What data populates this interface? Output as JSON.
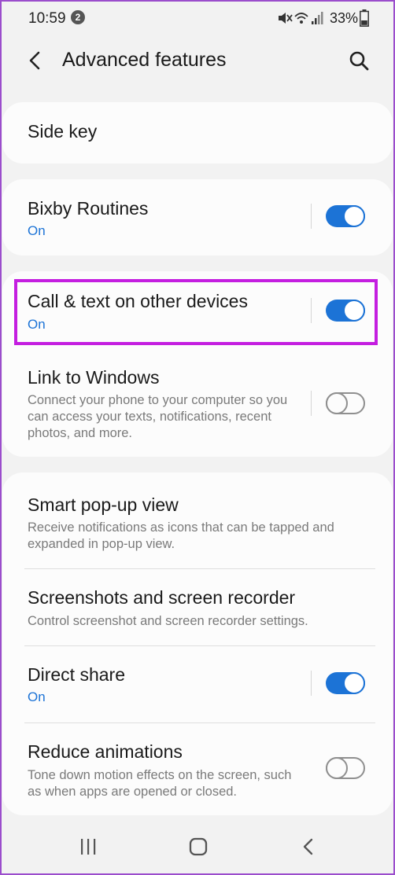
{
  "status_bar": {
    "time": "10:59",
    "notification_count": "2",
    "battery": "33%",
    "icons": [
      "mute-icon",
      "wifi-icon",
      "signal-icon",
      "battery-icon"
    ]
  },
  "header": {
    "title": "Advanced features",
    "back_icon": "back-arrow-icon",
    "search_icon": "search-icon"
  },
  "groups": [
    {
      "items": [
        {
          "title": "Side key"
        }
      ]
    },
    {
      "items": [
        {
          "title": "Bixby Routines",
          "status": "On",
          "toggle": true
        }
      ]
    },
    {
      "items": [
        {
          "title": "Call & text on other devices",
          "status": "On",
          "toggle": true,
          "highlighted": true
        },
        {
          "title": "Link to Windows",
          "description": "Connect your phone to your computer so you can access your texts, notifications, recent photos, and more.",
          "toggle": false
        }
      ]
    },
    {
      "items": [
        {
          "title": "Smart pop-up view",
          "description": "Receive notifications as icons that can be tapped and expanded in pop-up view."
        },
        {
          "title": "Screenshots and screen recorder",
          "description": "Control screenshot and screen recorder settings."
        },
        {
          "title": "Direct share",
          "status": "On",
          "toggle": true
        },
        {
          "title": "Reduce animations",
          "description": "Tone down motion effects on the screen, such as when apps are opened or closed.",
          "toggle": false
        }
      ]
    }
  ],
  "nav_bar": {
    "buttons": [
      "recent-apps-icon",
      "home-icon",
      "back-icon"
    ]
  },
  "colors": {
    "accent": "#1c73d6",
    "highlight": "#c41ee0",
    "background": "#f2f2f2",
    "card": "#fcfcfc"
  }
}
